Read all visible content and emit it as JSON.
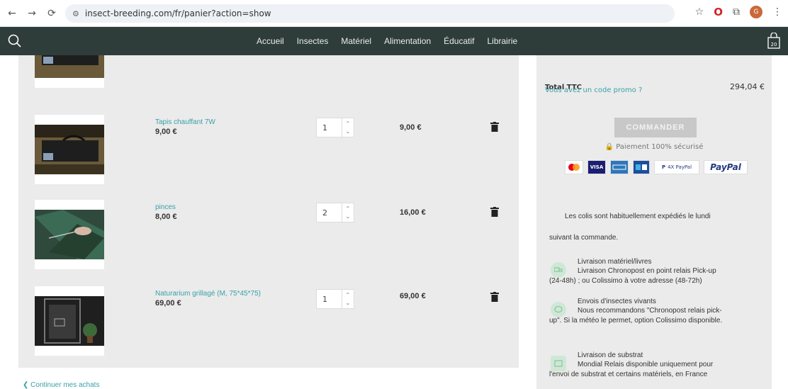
{
  "browser": {
    "url": "insect-breeding.com/fr/panier?action=show",
    "avatar_letter": "G"
  },
  "nav": {
    "menu": [
      "Accueil",
      "Insectes",
      "Matériel",
      "Alimentation",
      "Éducatif",
      "Librairie"
    ],
    "cart_count": "20"
  },
  "cart": {
    "items": [
      {
        "name": "Tapis chauffant 7W",
        "unit_price": "9,00 €",
        "qty": "1",
        "total": "9,00 €"
      },
      {
        "name": "pinces",
        "unit_price": "8,00 €",
        "qty": "2",
        "total": "16,00 €"
      },
      {
        "name": "Naturarium grillagé (M, 75*45*75)",
        "unit_price": "69,00 €",
        "qty": "1",
        "total": "69,00 €"
      }
    ],
    "continue_label": "Continuer mes achats"
  },
  "summary": {
    "total_label": "Total TTC",
    "total_value": "294,04 €",
    "promo_label": "Vous avez un code promo ?",
    "order_button": "COMMANDER",
    "secure_label": "Paiement 100% sécurisé",
    "payment_methods": [
      "VISA",
      "4X PayPal",
      "PayPal"
    ],
    "shipping_note_line1": "Les colis sont habituellement expédiés le lundi",
    "shipping_note_line2": "suivant la commande.",
    "shipping": [
      {
        "title": "Livraison matériel/livres",
        "line1": "Livraison Chronopost en point relais Pick-up",
        "line2": "(24-48h) ; ou Colissimo à votre adresse (48-72h)"
      },
      {
        "title": "Envois d'insectes vivants",
        "line1": "Nous recommandons \"Chronopost relais pick-",
        "line2": "up\". Si la météo le permet, option Colissimo disponible."
      },
      {
        "title": "Livraison de substrat",
        "line1": "Mondial Relais disponible uniquement pour",
        "line2": "l'envoi de substrat et certains matériels, en France"
      }
    ]
  },
  "colors": {
    "nav_bg": "#2f3d3a",
    "link": "#39a0a8",
    "panel_bg": "#ebebeb"
  }
}
